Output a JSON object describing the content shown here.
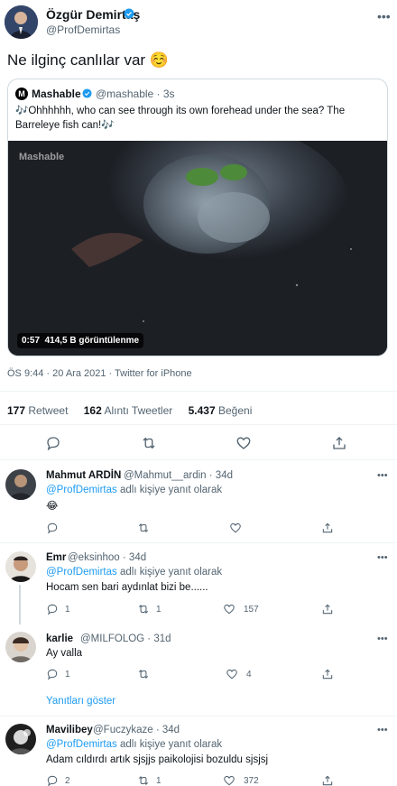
{
  "tweet": {
    "author_name": "Özgür Demirtaş",
    "author_handle": "@ProfDemirtas",
    "text": "Ne ilginç canlılar var ☺️",
    "meta": "ÖS 9:44 · 20 Ara 2021 · Twitter for iPhone",
    "stats": {
      "retweets": "177",
      "retweets_label": "Retweet",
      "quotes": "162",
      "quotes_label": "Alıntı Tweetler",
      "likes": "5.437",
      "likes_label": "Beğeni"
    }
  },
  "quote": {
    "logo_letter": "M",
    "name": "Mashable",
    "handle_time": "@mashable · 3s",
    "text": "🎶Ohhhhhh, who can see through its own forehead under the sea? The Barreleye fish can!🎶",
    "media_watermark": "Mashable",
    "media_duration": "0:57",
    "media_views": "414,5 B görüntülenme"
  },
  "replies": [
    {
      "name": "Mahmut ARDİN",
      "handle_time": "@Mahmut__ardin · 34d",
      "reply_to_handle": "@ProfDemirtas",
      "reply_to_suffix": "adlı kişiye yanıt olarak",
      "text": "😂",
      "replies": "",
      "retweets": "",
      "likes": ""
    },
    {
      "name": "Emr",
      "handle_time": "@eksinhoo · 34d",
      "reply_to_handle": "@ProfDemirtas",
      "reply_to_suffix": "adlı kişiye yanıt olarak",
      "text": "Hocam sen bari aydınlat bizi be......",
      "replies": "1",
      "retweets": "1",
      "likes": "157"
    },
    {
      "name": "karlie",
      "handle_time": "@MILFOLOG · 31d",
      "text": "Ay valla",
      "replies": "1",
      "retweets": "",
      "likes": "4"
    },
    {
      "name": "Mavilibey",
      "handle_time": "@Fuczykaze · 34d",
      "reply_to_handle": "@ProfDemirtas",
      "reply_to_suffix": "adlı kişiye yanıt olarak",
      "text": "Adam cıldırdı artık sjsjjs paikolojisi bozuldu sjsjsj",
      "replies": "2",
      "retweets": "1",
      "likes": "372"
    }
  ],
  "show_replies_label": "Yanıtları göster",
  "icons": [
    "more-icon",
    "verified-icon",
    "reply-icon",
    "retweet-icon",
    "like-icon",
    "share-icon"
  ],
  "colors": {
    "accent": "#1d9bf0",
    "muted": "#536471",
    "border": "#eff3f4"
  }
}
